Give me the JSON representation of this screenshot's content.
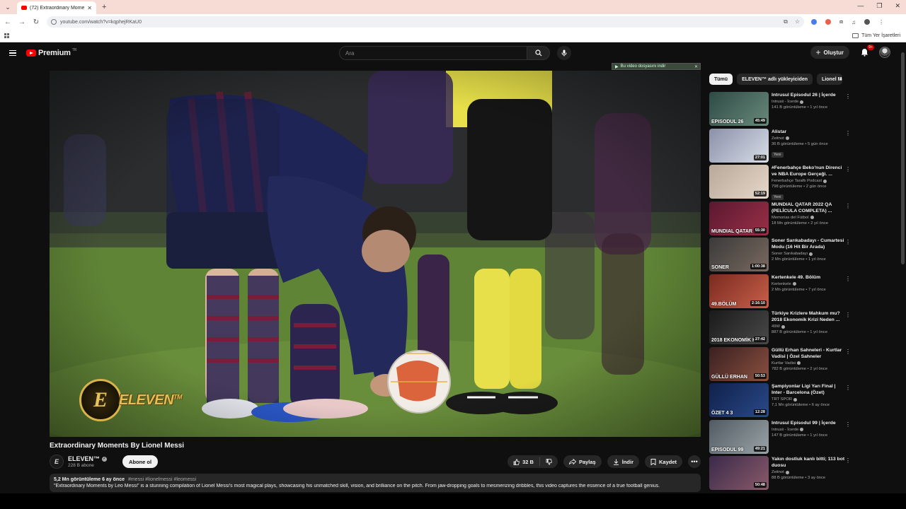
{
  "browser": {
    "tab_title": "(72) Extraordinary Moments B...",
    "tab_close": "✕",
    "new_tab": "+",
    "url": "youtube.com/watch?v=kqphejRKaU0",
    "bookmarks_folder": "Tüm Yer İşaretleri",
    "win_min": "—",
    "win_max": "❐",
    "win_close": "✕"
  },
  "header": {
    "logo_text": "Premium",
    "country_code": "TR",
    "search_placeholder": "Ara",
    "create_label": "Oluştur",
    "notifications_badge": "9+"
  },
  "player": {
    "download_hint": "Bu video dosyasını indir",
    "watermark_letter": "E",
    "watermark_text": "ELEVEN",
    "watermark_tm": "TM"
  },
  "video": {
    "title": "Extraordinary Moments By Lionel Messi",
    "channel_initial": "E",
    "channel_name": "ELEVEN™",
    "subscribers": "228 B abone",
    "subscribe_label": "Abone ol",
    "likes": "32 B",
    "share_label": "Paylaş",
    "download_label": "İndir",
    "save_label": "Kaydet",
    "views": "5,2 Mn görüntüleme",
    "age": "6 ay önce",
    "tags": "#messi #lionelmessi #leomessi",
    "description": "\"Extraordinary Moments by Leo Messi\" is a stunning compilation of Lionel Messi's most magical plays, showcasing his unmatched skill, vision, and brilliance on the pitch. From jaw-dropping goals to mesmerizing dribbles, this video captures the essence of a true football genius."
  },
  "chips": [
    "Tümü",
    "ELEVEN™ adlı yükleyiciden",
    "Lionel Mes"
  ],
  "recommendations": [
    {
      "title": "Intrusul Episodul 26 | İçerde",
      "channel": "Intrusii - İcerde",
      "meta": "141 B görüntüleme • 1 yıl önce",
      "duration": "45:49",
      "caption": "EPISODUL 26",
      "new": "",
      "c1": "#2d4a44",
      "c2": "#6a8a7c"
    },
    {
      "title": "Alistar",
      "channel": "Zeitnot",
      "meta": "36 B görüntüleme • 5 gün önce",
      "duration": "27:01",
      "caption": "",
      "new": "Yeni",
      "c1": "#8a90a8",
      "c2": "#d8dde8"
    },
    {
      "title": "#Fenerbahçe Beko'nun Direnci ve NBA Europe Gerçeği. ...",
      "channel": "Fenerbahçe Taraftı Podcast",
      "meta": "798 görüntüleme • 2 gün önce",
      "duration": "52:19",
      "caption": "",
      "new": "Yeni",
      "c1": "#b8a89a",
      "c2": "#e6d8c8"
    },
    {
      "title": "MUNDIAL QATAR 2022 QA (PELÍCULA COMPLETA) ...",
      "channel": "Memorias del Fútbol",
      "meta": "18 Mn görüntüleme • 2 yıl önce",
      "duration": "55:30",
      "caption": "MUNDIAL QATAR 2022",
      "new": "",
      "c1": "#5a1830",
      "c2": "#9a3048"
    },
    {
      "title": "Soner Sarıkabadayı - Cumartesi Modu (16 Hit Bir Arada)",
      "channel": "Soner Sarıkabadayı",
      "meta": "2 Mn görüntüleme • 1 yıl önce",
      "duration": "1:00:38",
      "caption": "SONER",
      "new": "",
      "c1": "#3a3a3a",
      "c2": "#7a6a60"
    },
    {
      "title": "Kertenkele 49. Bölüm",
      "channel": "Kertenkele",
      "meta": "2 Mn görüntüleme • 7 yıl önce",
      "duration": "2:16:10",
      "caption": "49.BÖLÜM",
      "new": "",
      "c1": "#7a2a20",
      "c2": "#c8604a"
    },
    {
      "title": "Türkiye Krizlere Mahkum mu? 2018 Ekonomik Krizi Neden ...",
      "channel": "49W",
      "meta": "887 B görüntüleme • 1 yıl önce",
      "duration": "27:42",
      "caption": "2018 EKONOMİK KRİZİ",
      "new": "",
      "c1": "#1a1a1a",
      "c2": "#4a4a4a"
    },
    {
      "title": "Güllü Erhan Sahneleri - Kurtlar Vadisi | Özel Sahneler",
      "channel": "Kurtlar Vadisi",
      "meta": "782 B görüntüleme • 2 yıl önce",
      "duration": "50:53",
      "caption": "GÜLLÜ ERHAN",
      "new": "",
      "c1": "#3a2020",
      "c2": "#8a5040"
    },
    {
      "title": "Şampiyonlar Ligi Yarı Final | Inter - Barcelona (Özet)",
      "channel": "TRT SPOR",
      "meta": "7,1 Mn görüntüleme • 6 ay önce",
      "duration": "12:28",
      "caption": "ÖZET 4 3",
      "new": "",
      "c1": "#10204a",
      "c2": "#2a4a8a"
    },
    {
      "title": "Intrusul Episodul 99 | İçerde",
      "channel": "Intrusii - İcerde",
      "meta": "147 B görüntüleme • 1 yıl önce",
      "duration": "49:21",
      "caption": "EPISODUL 99",
      "new": "",
      "c1": "#505a60",
      "c2": "#9aa4a8"
    },
    {
      "title": "Yakın dostluk kanlı bitti; 113 bot duosu",
      "channel": "Zeitnot",
      "meta": "88 B görüntüleme • 3 ay önce",
      "duration": "50:48",
      "caption": "",
      "new": "",
      "c1": "#3a2a4a",
      "c2": "#8a5a6a"
    }
  ],
  "colors": {
    "background": "#0f0f0f",
    "accent_red": "#ff0000",
    "watermark_gold": "#e2bf55",
    "pitch_green": "#6b8f3a"
  }
}
